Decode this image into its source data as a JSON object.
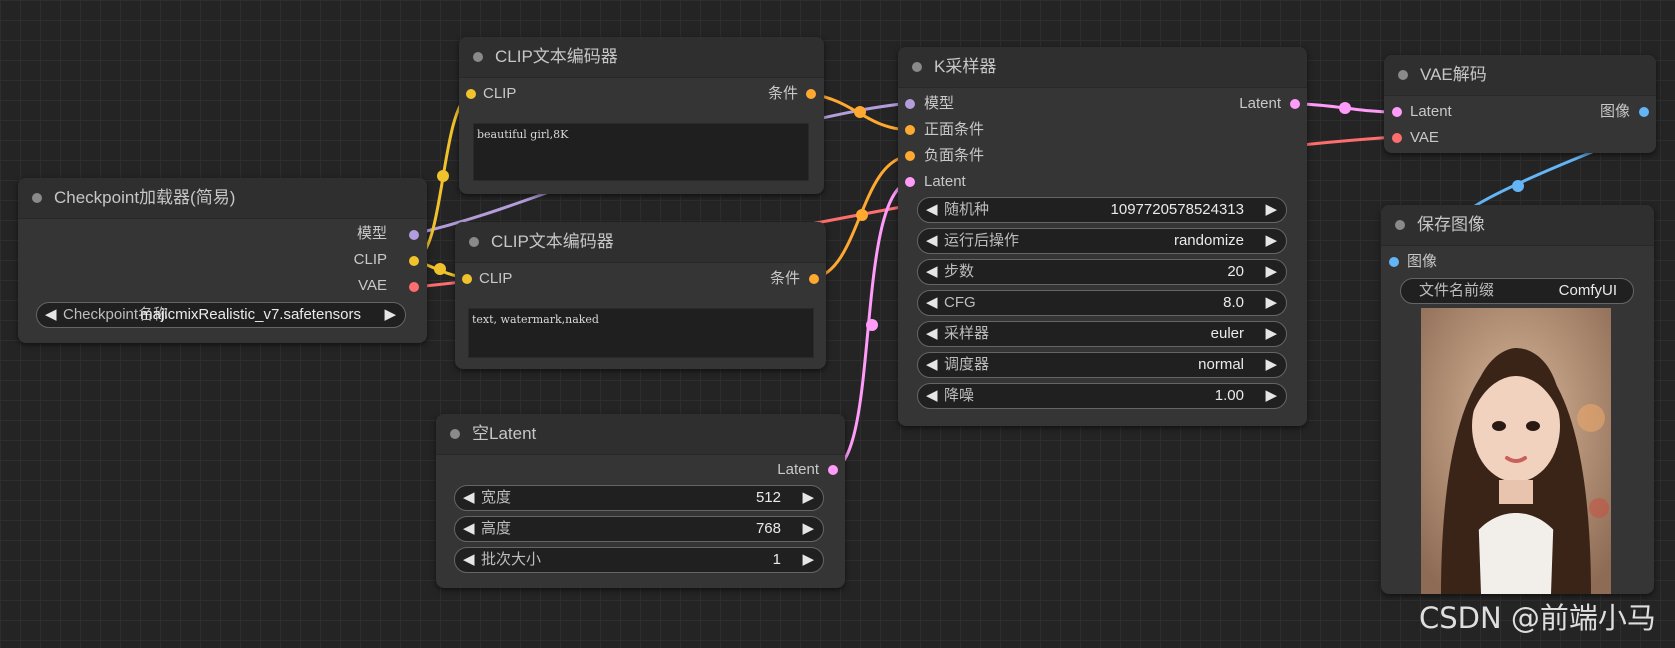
{
  "nodes": {
    "checkpoint": {
      "title": "Checkpoint加载器(简易)",
      "outputs": [
        "模型",
        "CLIP",
        "VAE"
      ],
      "widget_label": "Checkpoint名称",
      "widget_value": "majicmixRealistic_v7.safetensors"
    },
    "clip_pos": {
      "title": "CLIP文本编码器",
      "input": "CLIP",
      "output": "条件",
      "text": "beautiful girl,8K"
    },
    "clip_neg": {
      "title": "CLIP文本编码器",
      "input": "CLIP",
      "output": "条件",
      "text": "text, watermark,naked"
    },
    "empty_latent": {
      "title": "空Latent",
      "output": "Latent",
      "widgets": [
        {
          "label": "宽度",
          "value": "512"
        },
        {
          "label": "高度",
          "value": "768"
        },
        {
          "label": "批次大小",
          "value": "1"
        }
      ]
    },
    "ksampler": {
      "title": "K采样器",
      "inputs": [
        "模型",
        "正面条件",
        "负面条件",
        "Latent"
      ],
      "output": "Latent",
      "widgets": [
        {
          "label": "随机种",
          "value": "1097720578524313"
        },
        {
          "label": "运行后操作",
          "value": "randomize"
        },
        {
          "label": "步数",
          "value": "20"
        },
        {
          "label": "CFG",
          "value": "8.0"
        },
        {
          "label": "采样器",
          "value": "euler"
        },
        {
          "label": "调度器",
          "value": "normal"
        },
        {
          "label": "降噪",
          "value": "1.00"
        }
      ]
    },
    "vae_decode": {
      "title": "VAE解码",
      "inputs": [
        "Latent",
        "VAE"
      ],
      "output": "图像"
    },
    "save_image": {
      "title": "保存图像",
      "input": "图像",
      "widget_label": "文件名前缀",
      "widget_value": "ComfyUI"
    }
  },
  "watermark": "CSDN @前端小马",
  "colors": {
    "clip": "#f0c22c",
    "model": "#b39ddb",
    "vae": "#ff6e6e",
    "conditioning": "#ffa931",
    "latent": "#ff9cf9",
    "image": "#64b5f6",
    "background": "#242424",
    "node": "#353535"
  },
  "icons": {
    "decrement": "left-triangle-icon",
    "increment": "right-triangle-icon",
    "collapse": "dot-icon"
  }
}
